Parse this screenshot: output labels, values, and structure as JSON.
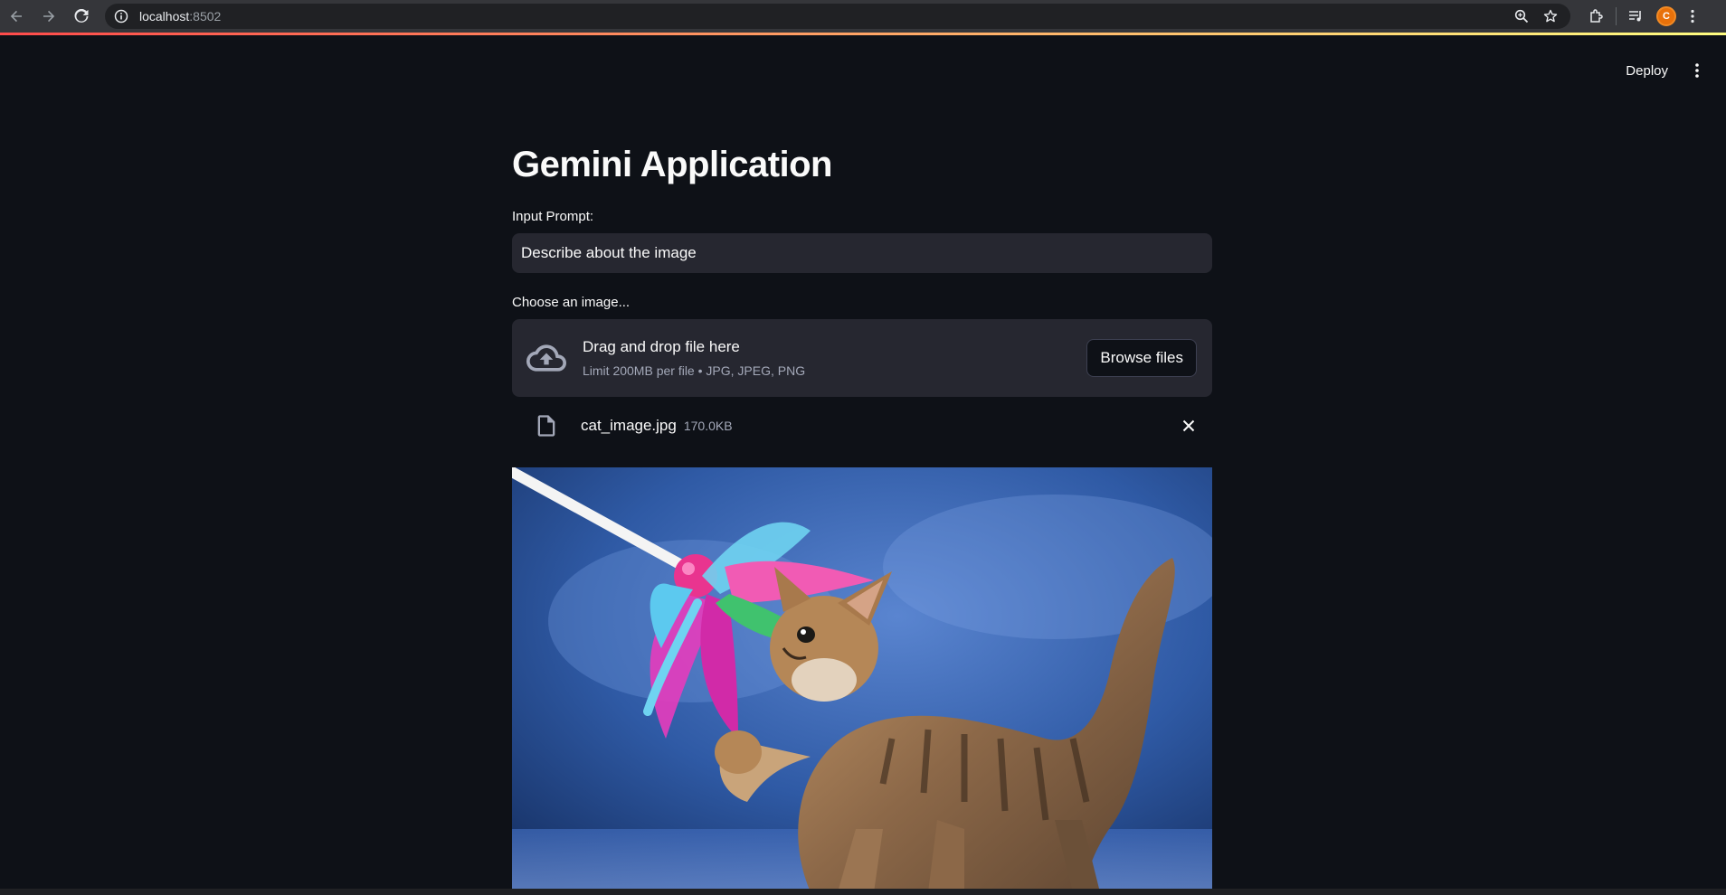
{
  "browser": {
    "url_host": "localhost",
    "url_port": ":8502",
    "avatar_letter": "C"
  },
  "header": {
    "deploy_label": "Deploy"
  },
  "main": {
    "title": "Gemini Application",
    "prompt_label": "Input Prompt:",
    "prompt_value": "Describe about the image",
    "upload_label": "Choose an image...",
    "dropzone_title": "Drag and drop file here",
    "dropzone_subtitle": "Limit 200MB per file • JPG, JPEG, PNG",
    "browse_label": "Browse files",
    "file_name": "cat_image.jpg",
    "file_size": "170.0KB"
  },
  "colors": {
    "background": "#0e1117",
    "widget_bg": "#262730",
    "accent_red": "#ff4b4b"
  },
  "icons": [
    "back-icon",
    "forward-icon",
    "reload-icon",
    "site-info-icon",
    "zoom-icon",
    "bookmark-star-icon",
    "extensions-icon",
    "media-icon",
    "kebab-menu-icon",
    "cloud-upload-icon",
    "file-icon",
    "close-icon"
  ]
}
